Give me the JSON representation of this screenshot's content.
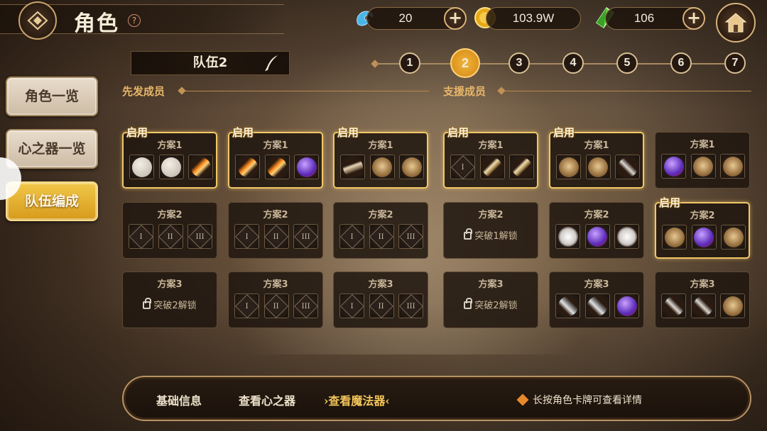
{
  "header": {
    "title": "角色",
    "help": "?",
    "resources": [
      {
        "name": "blue-spirit",
        "value": "20"
      },
      {
        "name": "gold-coin",
        "value": "103.9W"
      },
      {
        "name": "green-crystal",
        "value": "106"
      }
    ],
    "plus": "+"
  },
  "sidebar": {
    "items": [
      {
        "label": "角色一览"
      },
      {
        "label": "心之器一览"
      },
      {
        "label": "队伍编成"
      }
    ]
  },
  "team": {
    "name": "队伍2",
    "starters_label": "先发成员",
    "support_label": "支援成员",
    "steps": [
      "1",
      "2",
      "3",
      "4",
      "5",
      "6",
      "7"
    ],
    "active_step": "2"
  },
  "cards": {
    "enabled_tag": "启用",
    "columns": [
      {
        "plans": [
          {
            "title": "方案1",
            "enabled": true,
            "slots": [
              "vase-item",
              "vase-item",
              "sword-item"
            ]
          },
          {
            "title": "方案2",
            "enabled": false,
            "slots": [
              "I",
              "II",
              "III"
            ]
          },
          {
            "title": "方案3",
            "enabled": false,
            "locked": "突破2解锁"
          }
        ]
      },
      {
        "plans": [
          {
            "title": "方案1",
            "enabled": true,
            "slots": [
              "sword-item",
              "sword-item",
              "orb-item"
            ]
          },
          {
            "title": "方案2",
            "enabled": false,
            "slots": [
              "I",
              "II",
              "III"
            ]
          },
          {
            "title": "方案3",
            "enabled": false,
            "slots": [
              "I",
              "II",
              "III"
            ]
          }
        ]
      },
      {
        "plans": [
          {
            "title": "方案1",
            "enabled": true,
            "slots": [
              "staff-item",
              "shield-item",
              "shield-item"
            ]
          },
          {
            "title": "方案2",
            "enabled": false,
            "slots": [
              "I",
              "II",
              "III"
            ]
          },
          {
            "title": "方案3",
            "enabled": false,
            "slots": [
              "I",
              "II",
              "III"
            ]
          }
        ]
      },
      {
        "plans": [
          {
            "title": "方案1",
            "enabled": true,
            "slots": [
              "I",
              "key-item",
              "key-item"
            ]
          },
          {
            "title": "方案2",
            "enabled": false,
            "locked": "突破1解锁"
          },
          {
            "title": "方案3",
            "enabled": false,
            "locked": "突破2解锁"
          }
        ]
      },
      {
        "plans": [
          {
            "title": "方案1",
            "enabled": true,
            "slots": [
              "shield-item",
              "shield-item",
              "wand-item"
            ]
          },
          {
            "title": "方案2",
            "enabled": false,
            "slots": [
              "wing-item",
              "orb-item",
              "wing-item"
            ]
          },
          {
            "title": "方案3",
            "enabled": false,
            "slots": [
              "axe-item",
              "axe-item",
              "orb-item"
            ]
          }
        ]
      },
      {
        "plans": [
          {
            "title": "方案1",
            "enabled": false,
            "slots": [
              "orb-item",
              "shield-item",
              "shield-item"
            ]
          },
          {
            "title": "方案2",
            "enabled": true,
            "slots": [
              "shield-item",
              "orb-item",
              "shield-item"
            ]
          },
          {
            "title": "方案3",
            "enabled": false,
            "slots": [
              "wand-item",
              "wand-item",
              "shield-item"
            ]
          }
        ]
      }
    ]
  },
  "bottom": {
    "basic_info": "基础信息",
    "view_heart": "查看心之器",
    "view_magic": "查看魔法器",
    "hint": "长按角色卡牌可查看详情"
  },
  "colors": {
    "accent_gold": "#f2c45a",
    "enabled_border": "#f1c766",
    "active_tab": "#d69a1c"
  }
}
